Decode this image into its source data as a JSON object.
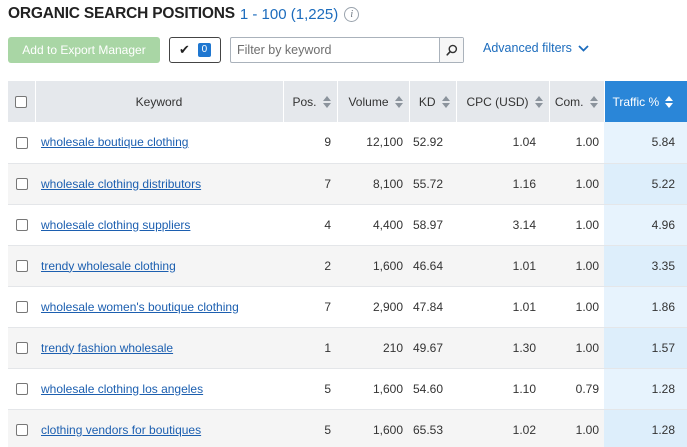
{
  "header": {
    "title": "ORGANIC SEARCH POSITIONS",
    "range": "1 - 100 (1,225)",
    "info_glyph": "i"
  },
  "toolbar": {
    "export_label": "Add to Export Manager",
    "selected_count": "0",
    "filter_placeholder": "Filter by keyword",
    "advanced_filters_label": "Advanced filters"
  },
  "table": {
    "columns": {
      "keyword": "Keyword",
      "pos": "Pos.",
      "volume": "Volume",
      "kd": "KD",
      "cpc": "CPC (USD)",
      "com": "Com.",
      "traffic": "Traffic %"
    },
    "rows": [
      {
        "keyword": "wholesale boutique clothing",
        "pos": "9",
        "volume": "12,100",
        "kd": "52.92",
        "cpc": "1.04",
        "com": "1.00",
        "traffic": "5.84"
      },
      {
        "keyword": "wholesale clothing distributors",
        "pos": "7",
        "volume": "8,100",
        "kd": "55.72",
        "cpc": "1.16",
        "com": "1.00",
        "traffic": "5.22"
      },
      {
        "keyword": "wholesale clothing suppliers",
        "pos": "4",
        "volume": "4,400",
        "kd": "58.97",
        "cpc": "3.14",
        "com": "1.00",
        "traffic": "4.96"
      },
      {
        "keyword": "trendy wholesale clothing",
        "pos": "2",
        "volume": "1,600",
        "kd": "46.64",
        "cpc": "1.01",
        "com": "1.00",
        "traffic": "3.35"
      },
      {
        "keyword": "wholesale women's boutique clothing",
        "pos": "7",
        "volume": "2,900",
        "kd": "47.84",
        "cpc": "1.01",
        "com": "1.00",
        "traffic": "1.86"
      },
      {
        "keyword": "trendy fashion wholesale",
        "pos": "1",
        "volume": "210",
        "kd": "49.67",
        "cpc": "1.30",
        "com": "1.00",
        "traffic": "1.57"
      },
      {
        "keyword": "wholesale clothing los angeles",
        "pos": "5",
        "volume": "1,600",
        "kd": "54.60",
        "cpc": "1.10",
        "com": "0.79",
        "traffic": "1.28"
      },
      {
        "keyword": "clothing vendors for boutiques",
        "pos": "5",
        "volume": "1,600",
        "kd": "65.53",
        "cpc": "1.02",
        "com": "1.00",
        "traffic": "1.28"
      }
    ]
  },
  "icons": {
    "info": "info-icon",
    "check": "check-icon",
    "search": "search-icon",
    "chevron": "chevron-down-icon",
    "sort": "sort-icon"
  },
  "colors": {
    "accent": "#2a86d8",
    "link": "#1c5fb0",
    "export_button": "#a9d6a5",
    "header_bg": "#e5e8ec",
    "traffic_highlight": "#e7f3fd"
  }
}
